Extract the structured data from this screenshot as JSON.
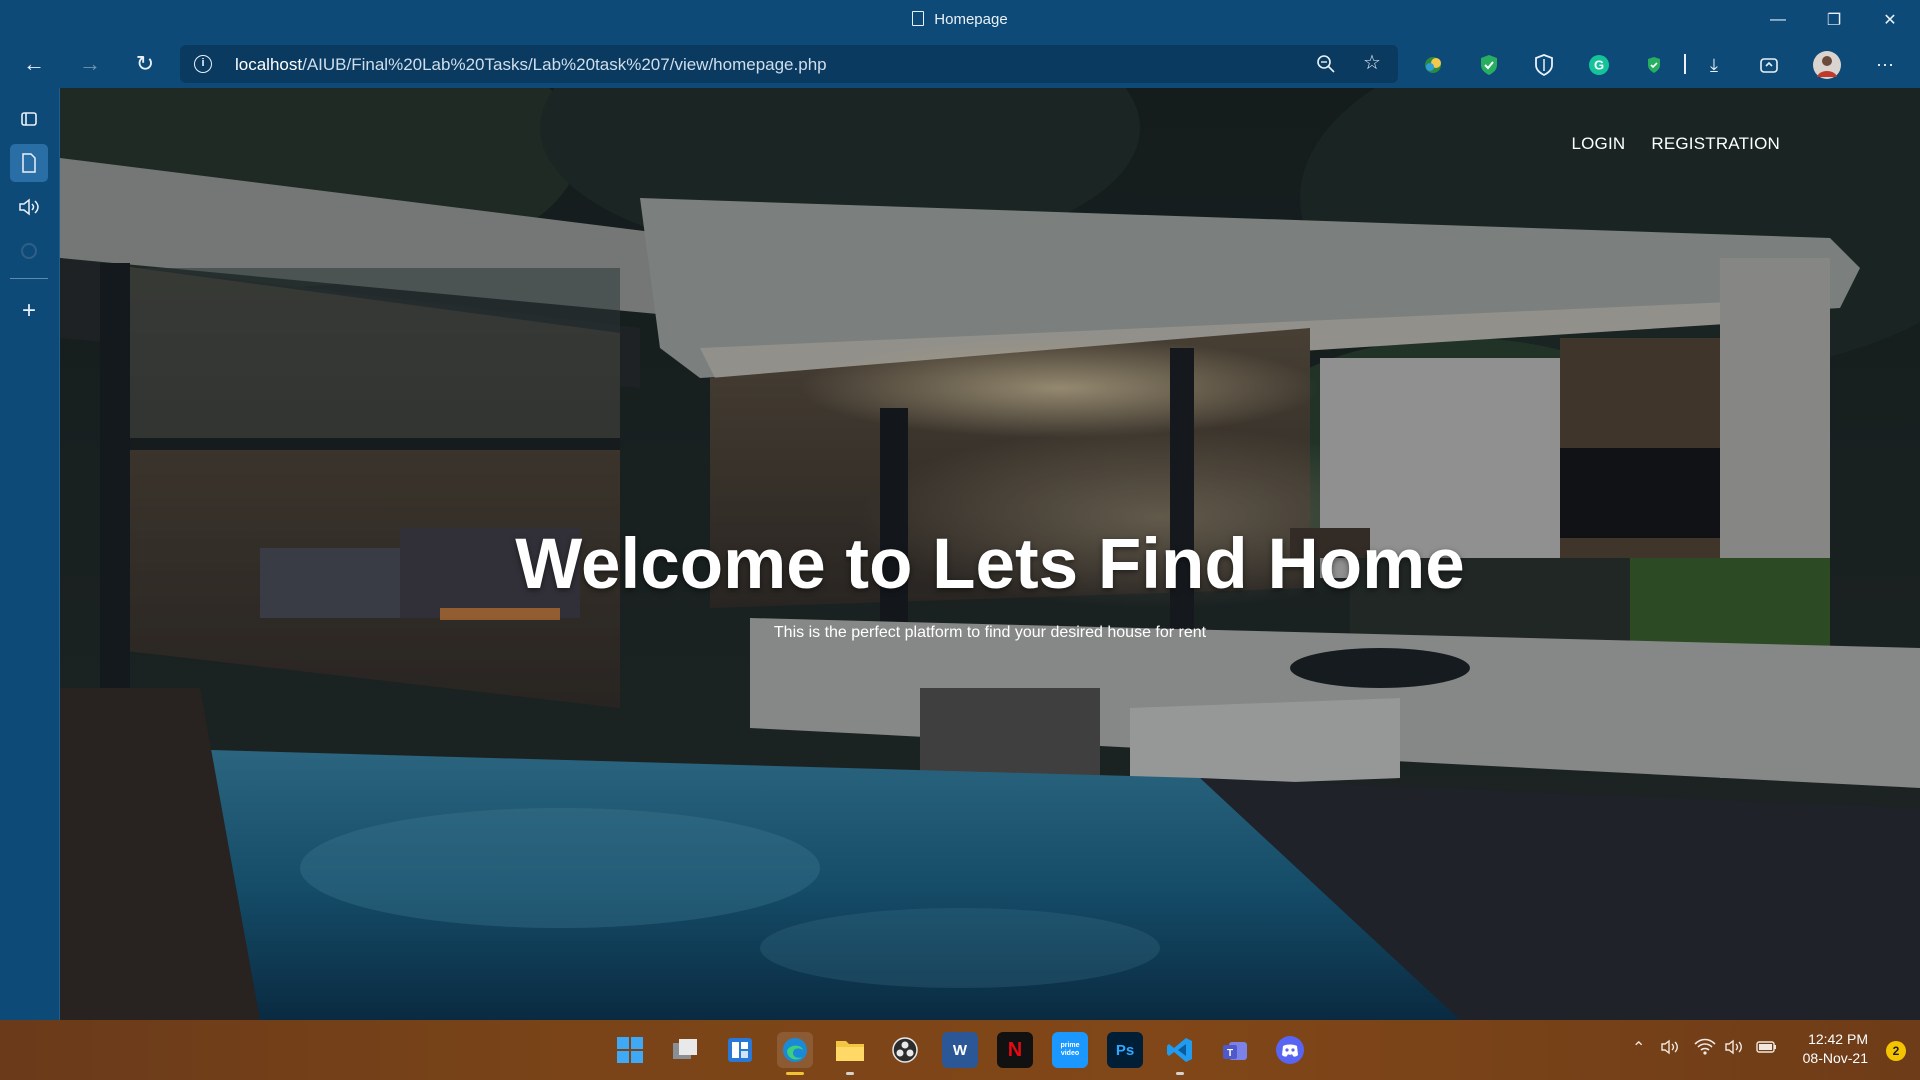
{
  "window": {
    "title": "Homepage",
    "minimize_icon": "minimize-icon",
    "restore_icon": "restore-icon",
    "close_icon": "close-icon"
  },
  "toolbar": {
    "url_host": "localhost",
    "url_path": "/AIUB/Final%20Lab%20Tasks/Lab%20task%207/view/homepage.php",
    "info_glyph": "i",
    "icons": [
      "back-icon",
      "forward-icon",
      "refresh-icon",
      "site-info-icon",
      "zoom-icon",
      "add-favorite-icon",
      "extension-icon",
      "shield-extension-icon",
      "privacy-badger-icon",
      "grammarly-icon",
      "password-manager-icon",
      "downloads-icon",
      "performance-icon",
      "profile-avatar-icon",
      "more-icon"
    ]
  },
  "sidebar": {
    "icons": [
      "tab-actions-icon",
      "collections-page-icon",
      "read-aloud-icon",
      "circle-icon",
      "add-icon"
    ]
  },
  "page": {
    "nav": {
      "login": "LOGIN",
      "registration": "REGISTRATION"
    },
    "headline": "Welcome to Lets Find Home",
    "subtitle": "This is the perfect platform to find your desired house for rent"
  },
  "taskbar": {
    "apps": [
      "start",
      "task-view",
      "widgets",
      "edge",
      "file-explorer",
      "obs",
      "word",
      "netflix",
      "prime-video",
      "photoshop",
      "vscode",
      "teams",
      "discord"
    ],
    "word_glyph": "W",
    "netflix_glyph": "N",
    "prime_glyph": "prime video",
    "ps_glyph": "Ps",
    "time": "12:42 PM",
    "date": "08-Nov-21",
    "notifications": "2"
  },
  "colors": {
    "chrome": "#0e4a78",
    "address_bar": "#0a3a60",
    "taskbar": "#7a4418",
    "headline": "#ffffff"
  }
}
